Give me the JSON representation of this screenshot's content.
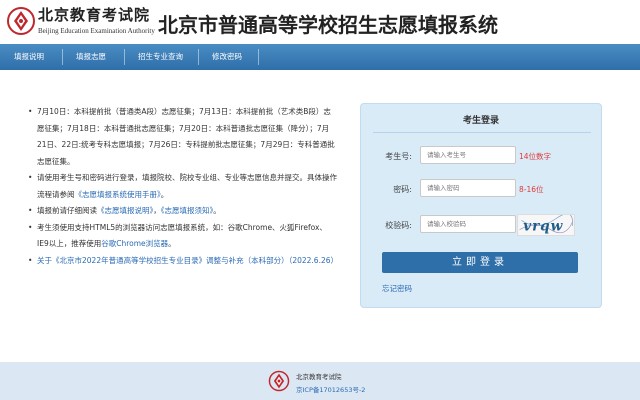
{
  "header": {
    "logo_cn": "北京教育考试院",
    "logo_en": "Beijing Education Examination Authority",
    "system_title": "北京市普通高等学校招生志愿填报系统"
  },
  "nav": {
    "items": [
      "填报说明",
      "填报志愿",
      "招生专业查询",
      "修改密码"
    ]
  },
  "info": {
    "item1": "7月10日：本科提前批（普通类A段）志愿征集；7月13日：本科提前批（艺术类B段）志愿征集；7月18日：本科普通批志愿征集；7月20日：本科普通批志愿征集（降分）；7月21日、22日:统考专科志愿填报；7月26日：专科提前批志愿征集；7月29日：专科普通批志愿征集。",
    "item2_text": "请使用考生号和密码进行登录，填报院校、院校专业组、专业等志愿信息并提交。具体操作流程请参阅",
    "item2_link": "《志愿填报系统使用手册》",
    "item2_end": "。",
    "item3_text": "填报前请仔细阅读",
    "item3_link1": "《志愿填报说明》",
    "item3_sep": "，",
    "item3_link2": "《志愿填报须知》",
    "item3_end": "。",
    "item4_text": "考生须使用支持HTML5的浏览器访问志愿填报系统，如：谷歌Chrome、火狐Firefox、IE9以上，推荐使用",
    "item4_link": "谷歌Chrome浏览器",
    "item4_end": "。",
    "item5": "关于《北京市2022年普通高等学校招生专业目录》调整与补充（本科部分）（2022.6.26）"
  },
  "login": {
    "title": "考生登录",
    "examinee_label": "考生号:",
    "examinee_placeholder": "请输入考生号",
    "examinee_hint": "14位数字",
    "password_label": "密码:",
    "password_placeholder": "请输入密码",
    "password_hint": "8-16位",
    "captcha_label": "校验码:",
    "captcha_placeholder": "请输入校验码",
    "captcha_text": "vrqw",
    "button": "立即登录",
    "forgot": "忘记密码"
  },
  "footer": {
    "name": "北京教育考试院",
    "icp": "京ICP备17012653号-2"
  },
  "colors": {
    "nav": "#3a7cb8",
    "button": "#2e6ea9",
    "panel": "#d9ebf7",
    "hint": "#e03a3a",
    "link": "#2a6ab5",
    "emblem": "#c0282e"
  }
}
